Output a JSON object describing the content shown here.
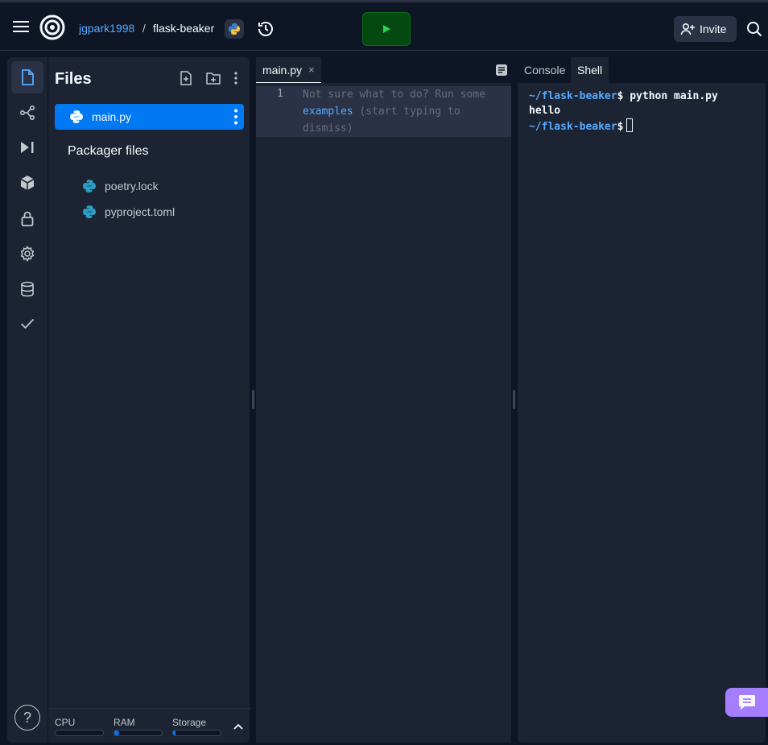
{
  "topbar": {
    "username": "jgpark1998",
    "separator": "/",
    "repl_name": "flask-beaker",
    "language_icon": "python-icon",
    "invite_label": "Invite"
  },
  "files_panel": {
    "title": "Files",
    "files": [
      {
        "name": "main.py",
        "selected": true
      }
    ],
    "packager_title": "Packager files",
    "packager_files": [
      {
        "name": "poetry.lock"
      },
      {
        "name": "pyproject.toml"
      }
    ],
    "resources": [
      {
        "label": "CPU",
        "level": 0.0
      },
      {
        "label": "RAM",
        "level": 0.1
      },
      {
        "label": "Storage",
        "level": 0.05
      }
    ]
  },
  "editor": {
    "tab_label": "main.py",
    "close_glyph": "×",
    "line_number": "1",
    "hint_prefix": "Not sure what to do? Run some",
    "hint_link": "examples",
    "hint_suffix": "(start typing to dismiss)"
  },
  "shell": {
    "tabs": [
      "Console",
      "Shell"
    ],
    "active_tab": "Shell",
    "lines": [
      {
        "path": "~/flask-beaker",
        "prompt": "$ ",
        "command": "python main.py"
      },
      {
        "output": "hello"
      },
      {
        "path": "~/flask-beaker",
        "prompt": "$",
        "command": ""
      }
    ]
  },
  "help_glyph": "?",
  "colors": {
    "background": "#0e1525",
    "panel": "#1c2333",
    "accent_blue": "#0079f2",
    "link_blue": "#57abff",
    "run_green": "#044a10",
    "chat_purple": "#a57eff"
  }
}
